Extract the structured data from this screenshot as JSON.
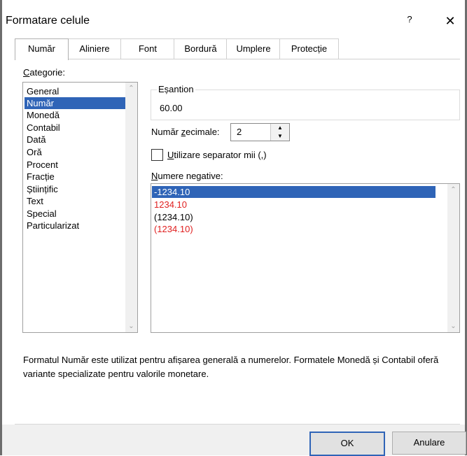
{
  "window": {
    "title": "Formatare celule",
    "help_label": "?",
    "close_label": "✕"
  },
  "tabs": [
    {
      "label": "Număr",
      "active": true
    },
    {
      "label": "Aliniere"
    },
    {
      "label": "Font"
    },
    {
      "label": "Bordură"
    },
    {
      "label": "Umplere"
    },
    {
      "label": "Protecție"
    }
  ],
  "category": {
    "label_first": "C",
    "label_rest": "ategorie:",
    "items": [
      "General",
      "Număr",
      "Monedă",
      "Contabil",
      "Dată",
      "Oră",
      "Procent",
      "Fracție",
      "Științific",
      "Text",
      "Special",
      "Particularizat"
    ],
    "selected": "Număr"
  },
  "sample": {
    "title": "Eșantion",
    "value": "60.00"
  },
  "decimals": {
    "label_before": "Număr ",
    "label_underlined": "z",
    "label_after": "ecimale:",
    "value": "2"
  },
  "separator": {
    "checked": false,
    "label_underlined": "U",
    "label_rest": "tilizare separator mii (,)"
  },
  "negatives": {
    "label_underlined": "N",
    "label_rest": "umere negative:",
    "items": [
      {
        "text": "-1234.10",
        "color": "#000000",
        "selected": true
      },
      {
        "text": "1234.10",
        "color": "#e02020"
      },
      {
        "text": "(1234.10)",
        "color": "#000000"
      },
      {
        "text": "(1234.10)",
        "color": "#e02020"
      }
    ]
  },
  "description": "Formatul Număr este utilizat pentru afișarea generală a numerelor. Formatele Monedă și Contabil oferă variante specializate pentru valorile monetare.",
  "buttons": {
    "ok": "OK",
    "cancel": "Anulare"
  },
  "icons": {
    "scroll_up": "chevron-up-icon",
    "scroll_down": "chevron-down-icon",
    "spin_up": "triangle-up-icon",
    "spin_down": "triangle-down-icon"
  },
  "colors": {
    "selection": "#2f64b7",
    "negative_red": "#e02020"
  }
}
